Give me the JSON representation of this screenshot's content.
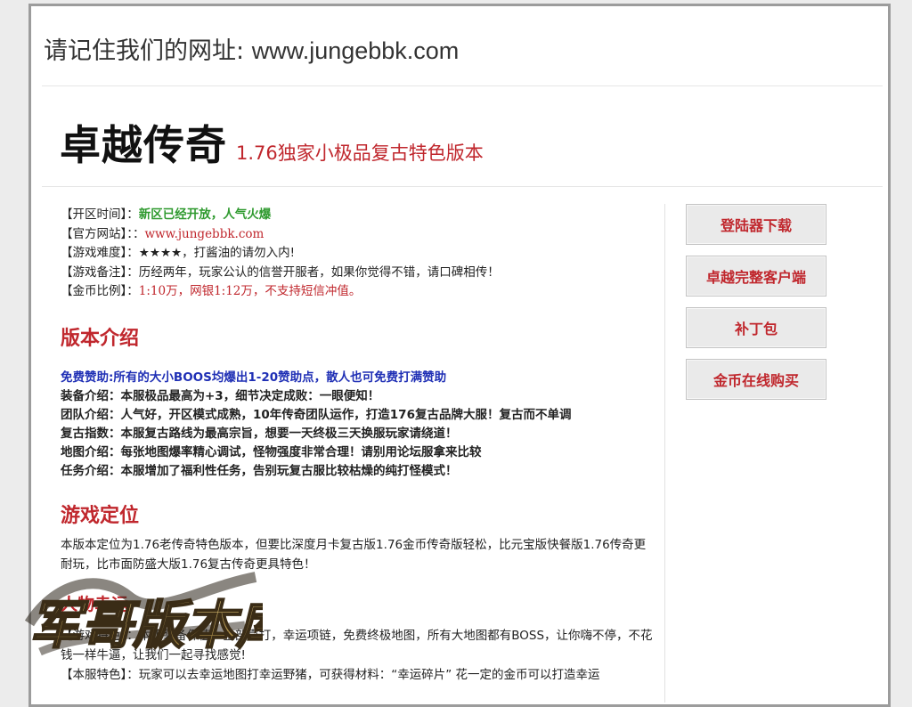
{
  "notice": {
    "prefix": "请记住我们的网址: ",
    "url": "www.jungebbk.com"
  },
  "header": {
    "title": "卓越传奇",
    "subtitle": "1.76独家小极品复古特色版本"
  },
  "info": [
    {
      "label": "【开区时间】：",
      "value": "新区已经开放，人气火爆"
    },
    {
      "label": "【官方网站】：",
      "sep": "：",
      "value": "www.jungebbk.com"
    },
    {
      "label": "【游戏难度】：",
      "value": "★★★★，打酱油的请勿入内!"
    },
    {
      "label": "【游戏备注】：",
      "value": "历经两年，玩家公认的信誉开服者，如果你觉得不错，请口碑相传！"
    },
    {
      "label": "【金币比例】：",
      "value": "1:10万，网银1:12万，不支持短信冲值。"
    }
  ],
  "version": {
    "heading": "版本介绍",
    "highlight": "免费赞助:所有的大小BOOS均爆出1-20赞助点，散人也可免费打满赞助",
    "lines": [
      "装备介绍：本服极品最高为+3，细节决定成败：一眼便知！",
      "团队介绍：人气好，开区模式成熟，10年传奇团队运作，打造176复古品牌大服！复古而不单调",
      "复古指数：本服复古路线为最高宗旨，想要一天终极三天换服玩家请绕道！",
      "地图介绍：每张地图爆率精心调试，怪物强度非常合理！请别用论坛服拿来比较",
      "任务介绍：本服增加了福利性任务，告别玩复古服比较枯燥的纯打怪模式！"
    ]
  },
  "positioning": {
    "heading": "游戏定位",
    "text": "本版本定位为1.76老传奇特色版本，但要比深度月卡复古版1.76金币传奇版轻松，比元宝版快餐版1.76传奇更耐玩，比市面防盛大版1.76复古传奇更具特色！"
  },
  "character": {
    "heading": "人物幸运",
    "features_label": "【游戏特色】：",
    "features_text": "本服装备保值，全部靠打，幸运项链，免费终极地图，所有大地图都有BOSS，让你嗨不停，不花钱一样牛逼，让我们一起寻找感觉!",
    "server_label": "【本服特色】：",
    "server_text": "玩家可以去幸运地图打幸运野猪，可获得材料：“幸运碎片” 花一定的金币可以打造幸运"
  },
  "sidebar": {
    "buttons": [
      "登陆器下载",
      "卓越完整客户端",
      "补丁包",
      "金币在线购买"
    ]
  },
  "watermark": {
    "text": "军哥版本库"
  },
  "colors": {
    "accent": "#c0272d",
    "green": "#2f9a2f",
    "blue": "#1f2fb5"
  }
}
